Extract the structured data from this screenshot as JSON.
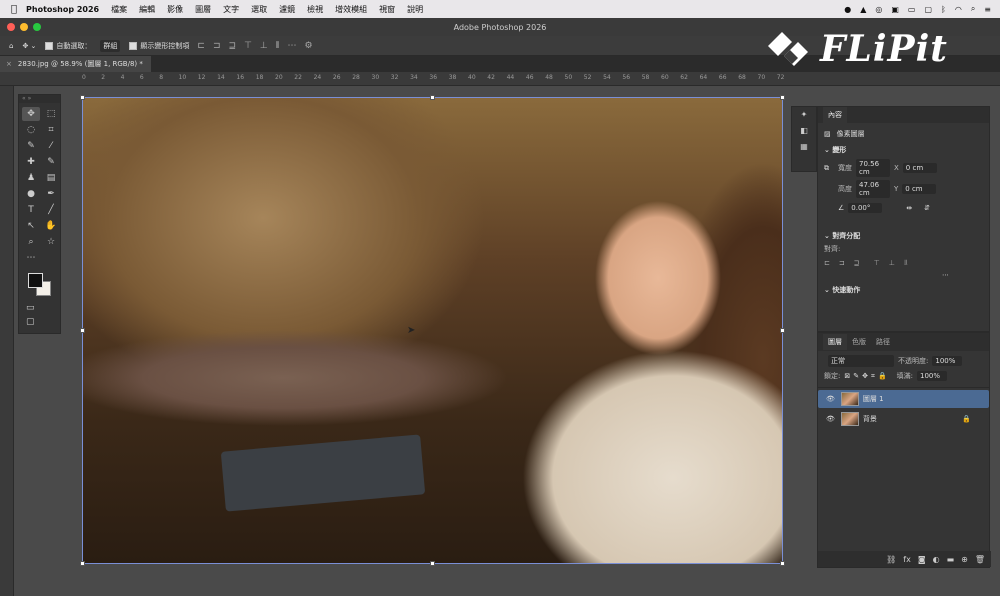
{
  "menubar": {
    "app": "Photoshop 2026",
    "items": [
      "檔案",
      "編輯",
      "影像",
      "圖層",
      "文字",
      "選取",
      "濾鏡",
      "檢視",
      "增效模組",
      "視窗",
      "說明"
    ]
  },
  "window": {
    "title": "Adobe Photoshop 2026"
  },
  "options": {
    "auto_select": "自動選取：",
    "group": "群組",
    "transform": "顯示變形控制項"
  },
  "document": {
    "tab": "2830.jpg @ 58.9% (圖層 1, RGB/8) *"
  },
  "ruler": {
    "ticks": [
      "0",
      "2",
      "4",
      "6",
      "8",
      "10",
      "12",
      "14",
      "16",
      "18",
      "20",
      "22",
      "24",
      "26",
      "28",
      "30",
      "32",
      "34",
      "36",
      "38",
      "40",
      "42",
      "44",
      "46",
      "48",
      "50",
      "52",
      "54",
      "56",
      "58",
      "60",
      "62",
      "64",
      "66",
      "68",
      "70",
      "72"
    ]
  },
  "properties": {
    "tab": "內容",
    "kind": "像素圖層",
    "transform": "變形",
    "w_label": "寬度",
    "w": "70.56 cm",
    "x_label": "X",
    "x": "0 cm",
    "h_label": "高度",
    "h": "47.06 cm",
    "y_label": "Y",
    "y": "0 cm",
    "angle": "0.00°",
    "align": "對齊分配",
    "align_sub": "對齊:",
    "quick": "快速動作"
  },
  "layers": {
    "tabs": [
      "圖層",
      "色版",
      "路徑"
    ],
    "blend": "正常",
    "opacity_label": "不透明度:",
    "opacity": "100%",
    "lock_label": "鎖定:",
    "fill_label": "填滿:",
    "fill": "100%",
    "items": [
      {
        "name": "圖層 1",
        "selected": true
      },
      {
        "name": "背景",
        "selected": false
      }
    ]
  },
  "logo": {
    "text": "FLiPit"
  }
}
